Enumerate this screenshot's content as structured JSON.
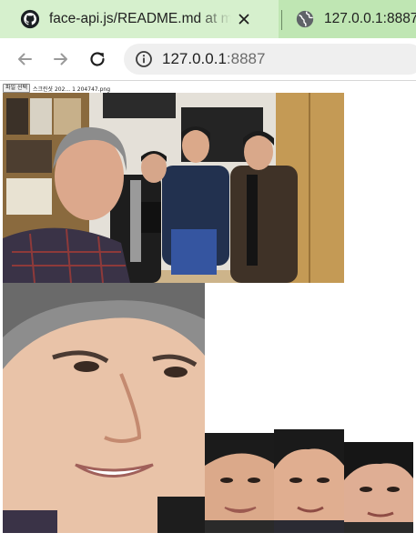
{
  "browser": {
    "tabs": [
      {
        "title": "face-api.js/README.md at master",
        "favicon": "github-icon",
        "active": true,
        "close_icon": "close-icon"
      },
      {
        "title": "127.0.0.1:8887",
        "favicon": "globe-icon",
        "active": false
      }
    ],
    "toolbar": {
      "back_icon": "arrow-left-icon",
      "forward_icon": "arrow-right-icon",
      "reload_icon": "reload-icon",
      "site_info_icon": "info-icon",
      "url_host": "127.0.0.1",
      "url_port": ":8887"
    }
  },
  "page": {
    "file_input": {
      "button_label": "파일 선택",
      "file_name": "스크린샷 202... 1 204747.png"
    },
    "images": {
      "group_photo": "group-photo",
      "detected_faces": [
        "face-crop-1",
        "face-crop-2",
        "face-crop-3",
        "face-crop-4"
      ]
    }
  }
}
